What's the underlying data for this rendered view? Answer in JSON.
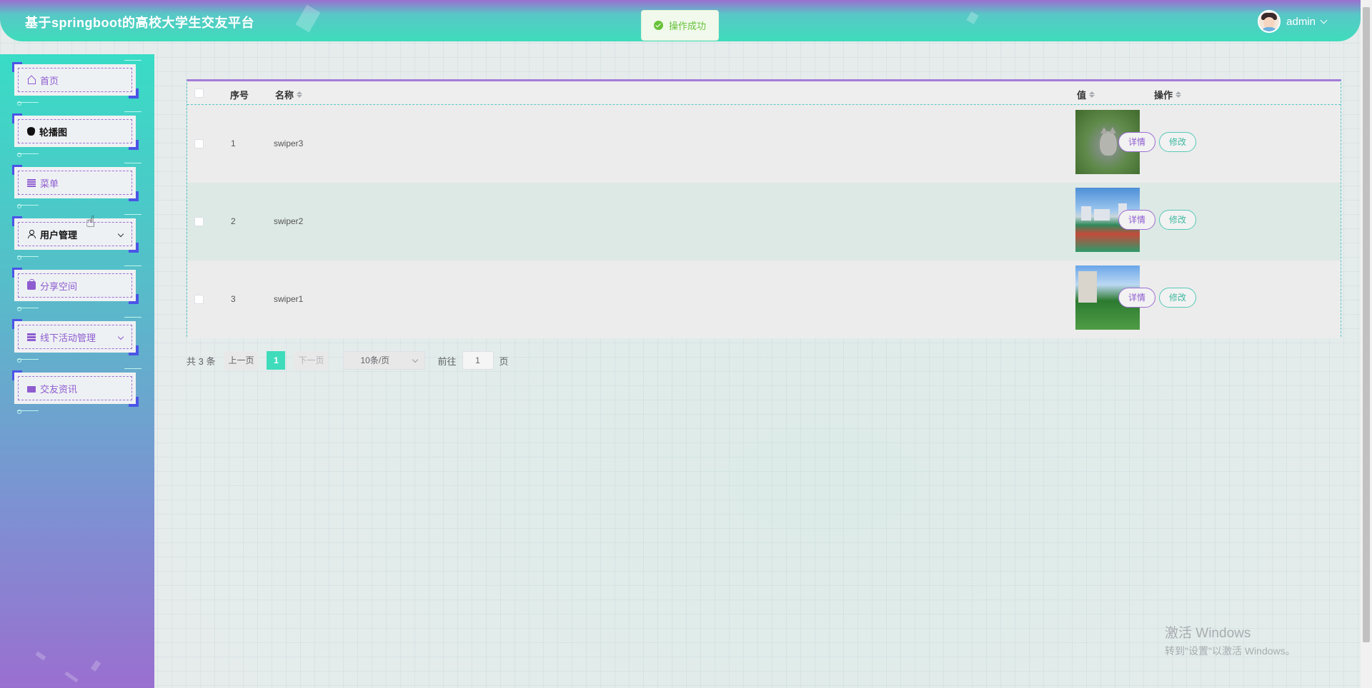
{
  "header": {
    "title": "基于springboot的高校大学生交友平台",
    "user_name": "admin"
  },
  "toast": {
    "message": "操作成功"
  },
  "sidebar": {
    "items": [
      {
        "label": "首页",
        "icon": "home-icon"
      },
      {
        "label": "轮播图",
        "icon": "drop-icon"
      },
      {
        "label": "菜单",
        "icon": "grid-icon"
      },
      {
        "label": "用户管理",
        "icon": "user-icon",
        "has_submenu": true
      },
      {
        "label": "分享空间",
        "icon": "bag-icon"
      },
      {
        "label": "线下活动管理",
        "icon": "stack-icon",
        "has_submenu": true
      },
      {
        "label": "交友资讯",
        "icon": "message-icon"
      }
    ]
  },
  "table": {
    "columns": [
      "序号",
      "名称",
      "值",
      "操作"
    ],
    "rows": [
      {
        "index": "1",
        "name": "swiper3",
        "image": "cat-photo"
      },
      {
        "index": "2",
        "name": "swiper2",
        "image": "campus-track-photo"
      },
      {
        "index": "3",
        "name": "swiper1",
        "image": "campus-building-photo"
      }
    ],
    "actions": {
      "detail": "详情",
      "edit": "修改"
    }
  },
  "pagination": {
    "total": "共 3 条",
    "prev": "上一页",
    "current": "1",
    "next": "下一页",
    "page_size": "10条/页",
    "goto_label": "前往",
    "goto_value": "1",
    "page_unit": "页"
  },
  "watermark": {
    "line1": "激活 Windows",
    "line2": "转到\"设置\"以激活 Windows。"
  },
  "colors": {
    "accent_purple": "#9d6ed3",
    "accent_teal": "#3fdcbc",
    "corner_blue": "#4b55e6",
    "success_green": "#67c23a"
  }
}
